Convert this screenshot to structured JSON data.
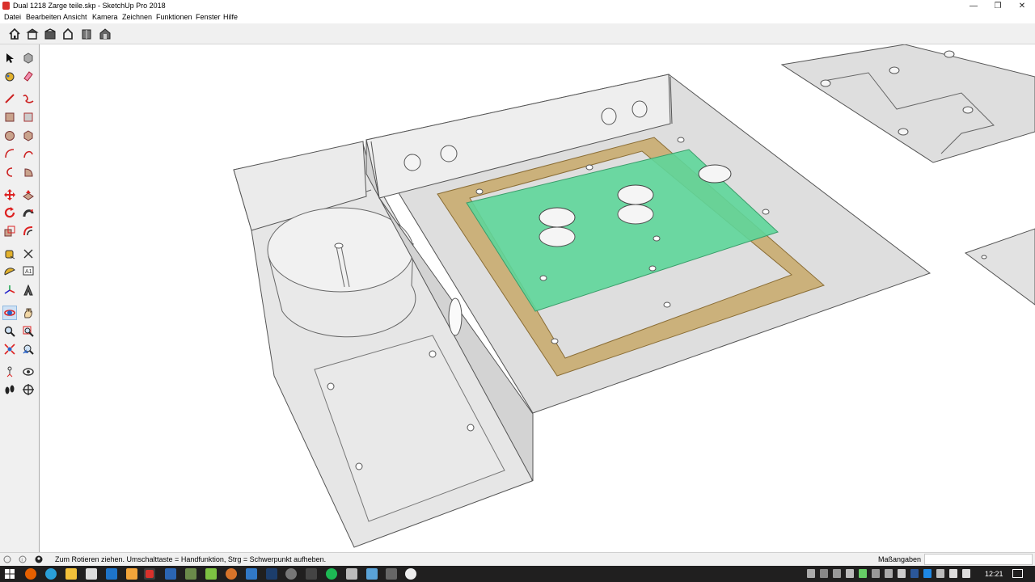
{
  "window": {
    "title": "Dual 1218 Zarge teile.skp - SketchUp Pro 2018",
    "controls": [
      "minimize-icon",
      "maximize-icon",
      "close-icon"
    ]
  },
  "menu": {
    "items": [
      "Datei",
      "Bearbeiten",
      "Ansicht",
      "Kamera",
      "Zeichnen",
      "Funktionen",
      "Fenster",
      "Hilfe"
    ]
  },
  "views_toolbar": {
    "icons": [
      "iso-view-icon",
      "top-view-icon",
      "front-view-icon",
      "right-view-icon",
      "back-view-icon",
      "left-view-icon"
    ]
  },
  "tools": {
    "icons": [
      "select-icon",
      "component-icon",
      "paint-bucket-icon",
      "eraser-icon",
      "line-icon",
      "freehand-icon",
      "rectangle-icon",
      "rotated-rectangle-icon",
      "circle-icon",
      "polygon-icon",
      "arc-icon",
      "two-point-arc-icon",
      "three-point-arc-icon",
      "pie-icon",
      "move-icon",
      "push-pull-icon",
      "rotate-icon",
      "follow-me-icon",
      "scale-icon",
      "offset-icon",
      "tape-measure-icon",
      "dimension-icon",
      "protractor-icon",
      "text-icon",
      "axes-icon",
      "3d-text-icon",
      "orbit-icon",
      "pan-icon",
      "zoom-icon",
      "zoom-window-icon",
      "zoom-extents-icon",
      "previous-view-icon",
      "position-camera-icon",
      "look-around-icon",
      "walk-icon",
      "section-plane-icon"
    ],
    "active": "orbit-icon"
  },
  "status": {
    "text": "Zum Rotieren ziehen. Umschalttaste = Handfunktion, Strg = Schwerpunkt aufheben.",
    "measurements_label": "Maßangaben",
    "measurements_value": ""
  },
  "taskbar": {
    "clock": "12:21"
  },
  "colors": {
    "pcb_green": "#5ed69a",
    "board_brown": "#c8a96a",
    "geometry_gray": "#e4e4e4",
    "edge": "#555555"
  }
}
